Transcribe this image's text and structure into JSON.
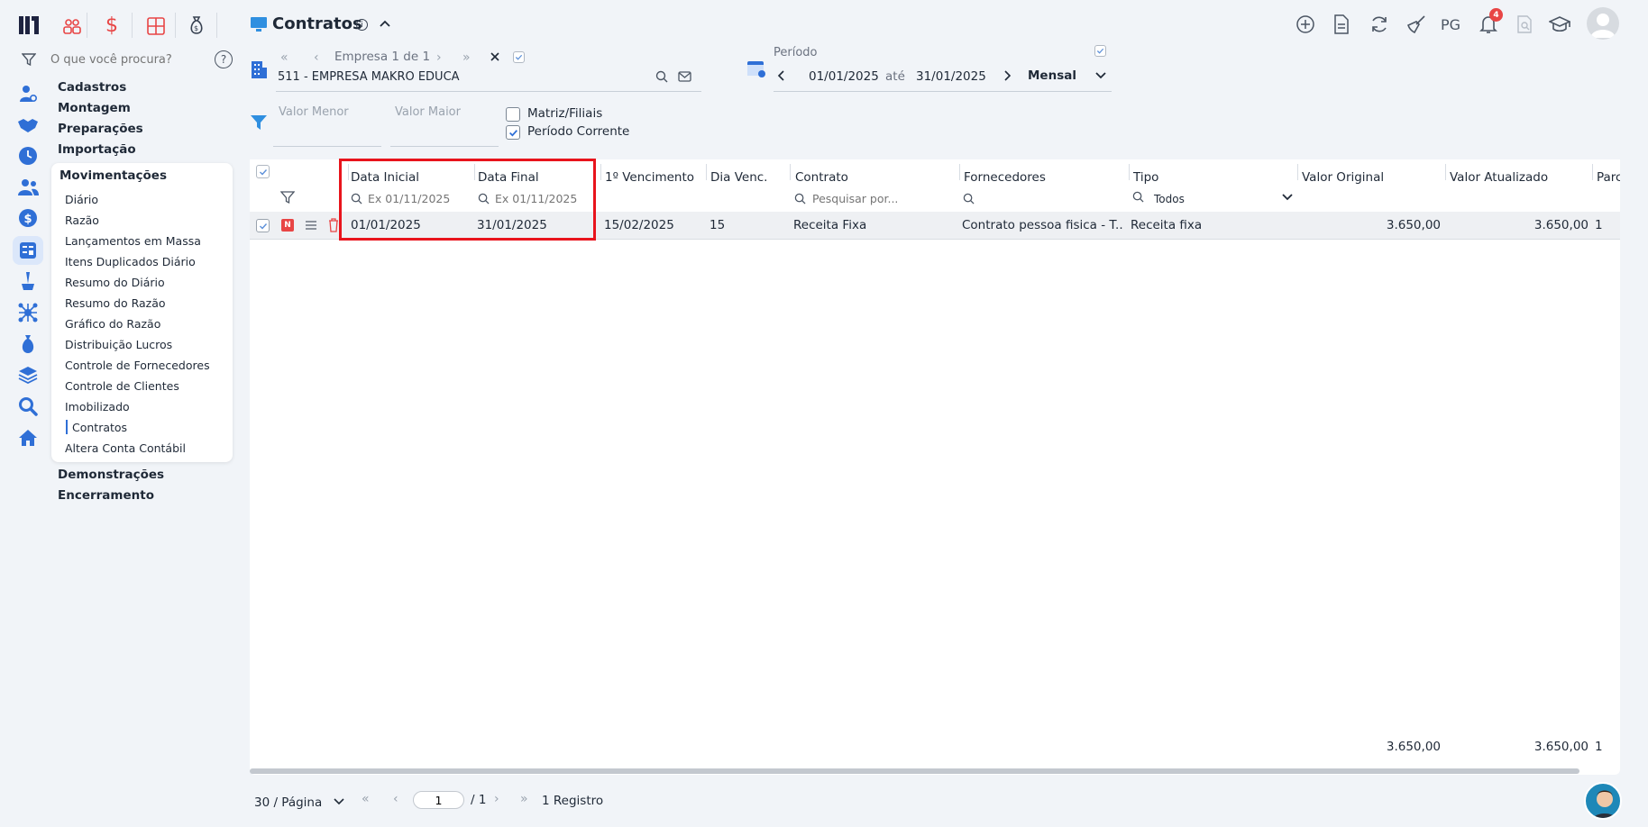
{
  "search": {
    "placeholder": "O que você procura?"
  },
  "header": {
    "title": "Contratos",
    "user_initials": "PG",
    "notification_count": "4"
  },
  "empresa": {
    "nav_label": "Empresa 1 de 1",
    "value": "511 - EMPRESA MAKRO EDUCA"
  },
  "periodo": {
    "label": "Período",
    "start": "01/01/2025",
    "sep": "até",
    "end": "31/01/2025",
    "mode": "Mensal"
  },
  "filters": {
    "valor_menor": "Valor Menor",
    "valor_maior": "Valor Maior",
    "matriz_filiais": "Matriz/Filiais",
    "periodo_corrente": "Período Corrente"
  },
  "menu": {
    "sections_top": [
      "Cadastros",
      "Montagem",
      "Preparações",
      "Importação"
    ],
    "active_section": "Movimentações",
    "items": [
      "Diário",
      "Razão",
      "Lançamentos em Massa",
      "Itens Duplicados Diário",
      "Resumo do Diário",
      "Resumo do Razão",
      "Gráfico do Razão",
      "Distribuição Lucros",
      "Controle de Fornecedores",
      "Controle de Clientes",
      "Imobilizado",
      "Contratos",
      "Altera Conta Contábil"
    ],
    "sections_bottom": [
      "Demonstrações",
      "Encerramento"
    ]
  },
  "table": {
    "columns": [
      "Data Inicial",
      "Data Final",
      "1º Vencimento",
      "Dia Venc.",
      "Contrato",
      "Fornecedores",
      "Tipo",
      "Valor Original",
      "Valor Atualizado",
      "Parc"
    ],
    "filter_placeholders": {
      "data_inicial": "Ex 01/11/2025",
      "data_final": "Ex 01/11/2025",
      "contrato": "Pesquisar por...",
      "tipo": "Todos"
    },
    "row_badge": "N",
    "rows": [
      {
        "data_inicial": "01/01/2025",
        "data_final": "31/01/2025",
        "vencimento": "15/02/2025",
        "dia_venc": "15",
        "contrato": "Receita Fixa",
        "fornecedores": "Contrato pessoa fisica - T...",
        "tipo": "Receita fixa",
        "valor_original": "3.650,00",
        "valor_atualizado": "3.650,00",
        "parc": "1"
      }
    ],
    "totals": {
      "valor_original": "3.650,00",
      "valor_atualizado": "3.650,00",
      "parc": "1"
    }
  },
  "pagination": {
    "per_page": "30 / Página",
    "page": "1",
    "of": "/ 1",
    "records": "1 Registro"
  }
}
